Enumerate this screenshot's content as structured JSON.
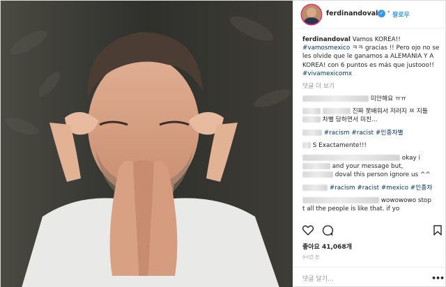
{
  "post": {
    "username": "ferdinandoval",
    "follow_label": "팔로우",
    "verified_symbol": "✓"
  },
  "caption": {
    "username": "ferdinandoval",
    "line1": "Vamos KOREA!!",
    "tag_vamosmexico": "#vamosmexico",
    "text1": "ㅋㅋ gracias !! Pero ojo no se les olvide que le ganamos a ALEMANIA Y A KOREA! con 6 puntos es más que justooo!!",
    "tag_vivamexicomx": "#vivamexicomx"
  },
  "more_comments_label": "댓글 더 보기",
  "comments": [
    {
      "text": "미안해요 ㅠㅠ"
    },
    {
      "text": "진짜 못배워서 저러지 ㅉ 지들",
      "text2": "차별 당하면서 미친..."
    },
    {
      "tags": [
        "#racism",
        "#racist",
        "#인종차별"
      ]
    },
    {
      "text": "S Exactamente!!!"
    },
    {
      "text": "okay i",
      "text2": "and your message but,",
      "text3": "doval this person ignore us ^^"
    },
    {
      "tags": [
        "#racism",
        "#racist",
        "#mexico",
        "#인종차"
      ]
    },
    {
      "text": "wowowowo stop",
      "text2": "t all the people is like that. if yo"
    }
  ],
  "likes_label": "좋아요 41,068개",
  "time_label": "9시간 전",
  "add_comment_placeholder": "댓글 달기...",
  "more_icon_glyph": "•••",
  "icons": [
    "heart-icon",
    "comment-icon",
    "bookmark-icon",
    "more-options-icon"
  ],
  "colors": {
    "link": "#3897f0",
    "hashtag": "#003569",
    "muted": "#999999",
    "border": "#efefef"
  }
}
